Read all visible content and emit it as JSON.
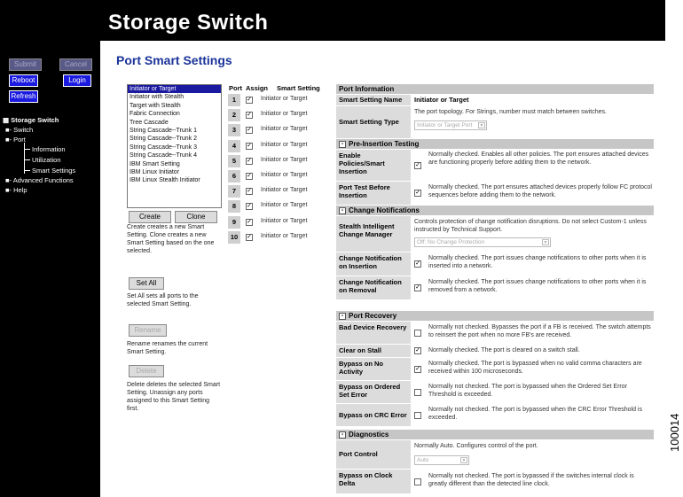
{
  "header": {
    "title": "Storage Switch"
  },
  "nav": {
    "buttons": {
      "submit": "Submit",
      "cancel": "Cancel",
      "reboot": "Reboot",
      "login": "Login",
      "refresh": "Refresh"
    },
    "tree": {
      "root": "Storage Switch",
      "switch": "Switch",
      "port": "Port",
      "information": "Information",
      "utilization": "Utilization",
      "smart_settings": "Smart Settings",
      "advanced": "Advanced Functions",
      "help": "Help"
    }
  },
  "page": {
    "title": "Port Smart Settings"
  },
  "smart_list": {
    "items": [
      "Initiator or Target",
      "Initiator with Stealth",
      "Target with Stealth",
      "Fabric Connection",
      "Tree Cascade",
      "String Cascade--Trunk 1",
      "String Cascade--Trunk 2",
      "String Cascade--Trunk 3",
      "String Cascade--Trunk 4",
      "IBM Smart Setting",
      "IBM Linux Initiator",
      "IBM Linux Stealth Initiator"
    ],
    "selected_index": 0
  },
  "actions": {
    "create": "Create",
    "clone": "Clone",
    "create_desc": "Create creates a new Smart Setting. Clone creates a new Smart Setting based on the one selected.",
    "set_all": "Set All",
    "set_all_desc": "Set All sets all ports to the selected Smart Setting.",
    "rename": "Rename",
    "rename_desc": "Rename renames the current Smart Setting.",
    "delete": "Delete",
    "delete_desc": "Delete deletes the selected Smart Setting. Unassign any ports assigned to this Smart Setting first."
  },
  "port_table": {
    "headers": {
      "port": "Port",
      "assign": "Assign",
      "setting": "Smart Setting"
    },
    "rows": [
      {
        "port": "1",
        "checked": "✓",
        "setting": "Initiator or Target"
      },
      {
        "port": "2",
        "checked": "✓",
        "setting": "Initiator or Target"
      },
      {
        "port": "3",
        "checked": "✓",
        "setting": "Initiator or Target"
      },
      {
        "port": "4",
        "checked": "✓",
        "setting": "Initiator or Target"
      },
      {
        "port": "5",
        "checked": "✓",
        "setting": "Initiator or Target"
      },
      {
        "port": "6",
        "checked": "✓",
        "setting": "Initiator or Target"
      },
      {
        "port": "7",
        "checked": "✓",
        "setting": "Initiator or Target"
      },
      {
        "port": "8",
        "checked": "✓",
        "setting": "Initiator or Target"
      },
      {
        "port": "9",
        "checked": "✓",
        "setting": "Initiator or Target"
      },
      {
        "port": "10",
        "checked": "✓",
        "setting": "Initiator or Target"
      }
    ]
  },
  "info": {
    "port_info_head": "Port Information",
    "smart_setting_name_label": "Smart Setting Name",
    "smart_setting_name_value": "Initiator or Target",
    "smart_setting_type_label": "Smart Setting Type",
    "smart_setting_type_desc": "The port topology. For Strings, number must match between switches.",
    "smart_setting_type_value": "Initiator or Target Port",
    "sec_preinsertion": "Pre-Insertion Testing",
    "enable_policies_label": "Enable Policies/Smart Insertion",
    "enable_policies_desc": "Normally checked. Enables all other policies. The port ensures attached devices are functioning properly before adding them to the network.",
    "port_test_label": "Port Test Before Insertion",
    "port_test_desc": "Normally checked. The port ensures attached devices properly follow FC protocol sequences before adding them to the network.",
    "sec_change": "Change Notifications",
    "stealth_label": "Stealth Intelligent Change Manager",
    "stealth_desc": "Controls protection of change notification disruptions. Do not select Custom-1 unless instructed by Technical Support.",
    "stealth_value": "Off: No Change Protection",
    "cn_insert_label": "Change Notification on Insertion",
    "cn_insert_desc": "Normally checked. The port issues change notifications to other ports when it is inserted into a network.",
    "cn_remove_label": "Change Notification on Removal",
    "cn_remove_desc": "Normally checked. The port issues change notifications to other ports when it is removed from a network.",
    "sec_recovery": "Port Recovery",
    "bad_device_label": "Bad Device Recovery",
    "bad_device_desc": "Normally not checked. Bypasses the port if a FB is received. The switch attempts to reinsert the port when no more FB's are received.",
    "clear_stall_label": "Clear on Stall",
    "clear_stall_desc": "Normally checked. The port is cleared on a switch stall.",
    "bypass_activity_label": "Bypass on No Activity",
    "bypass_activity_desc": "Normally checked. The port is bypassed when no valid comma characters are received within 100 microseconds.",
    "bypass_ordered_label": "Bypass on Ordered Set Error",
    "bypass_ordered_desc": "Normally not checked. The port is bypassed when the Ordered Set Error Threshold is exceeded.",
    "bypass_crc_label": "Bypass on CRC Error",
    "bypass_crc_desc": "Normally not checked. The port is bypassed when the CRC Error Threshold is exceeded.",
    "sec_diag": "Diagnostics",
    "port_control_label": "Port Control",
    "port_control_desc": "Normally Auto. Configures control of the port.",
    "port_control_value": "Auto",
    "bypass_clock_label": "Bypass on Clock Delta",
    "bypass_clock_desc": "Normally not checked. The port is bypassed if the switches internal clock is greatly different than the detected line clock.",
    "check_mark": "✓",
    "expand_mark": "-"
  },
  "figure_id": "100014"
}
